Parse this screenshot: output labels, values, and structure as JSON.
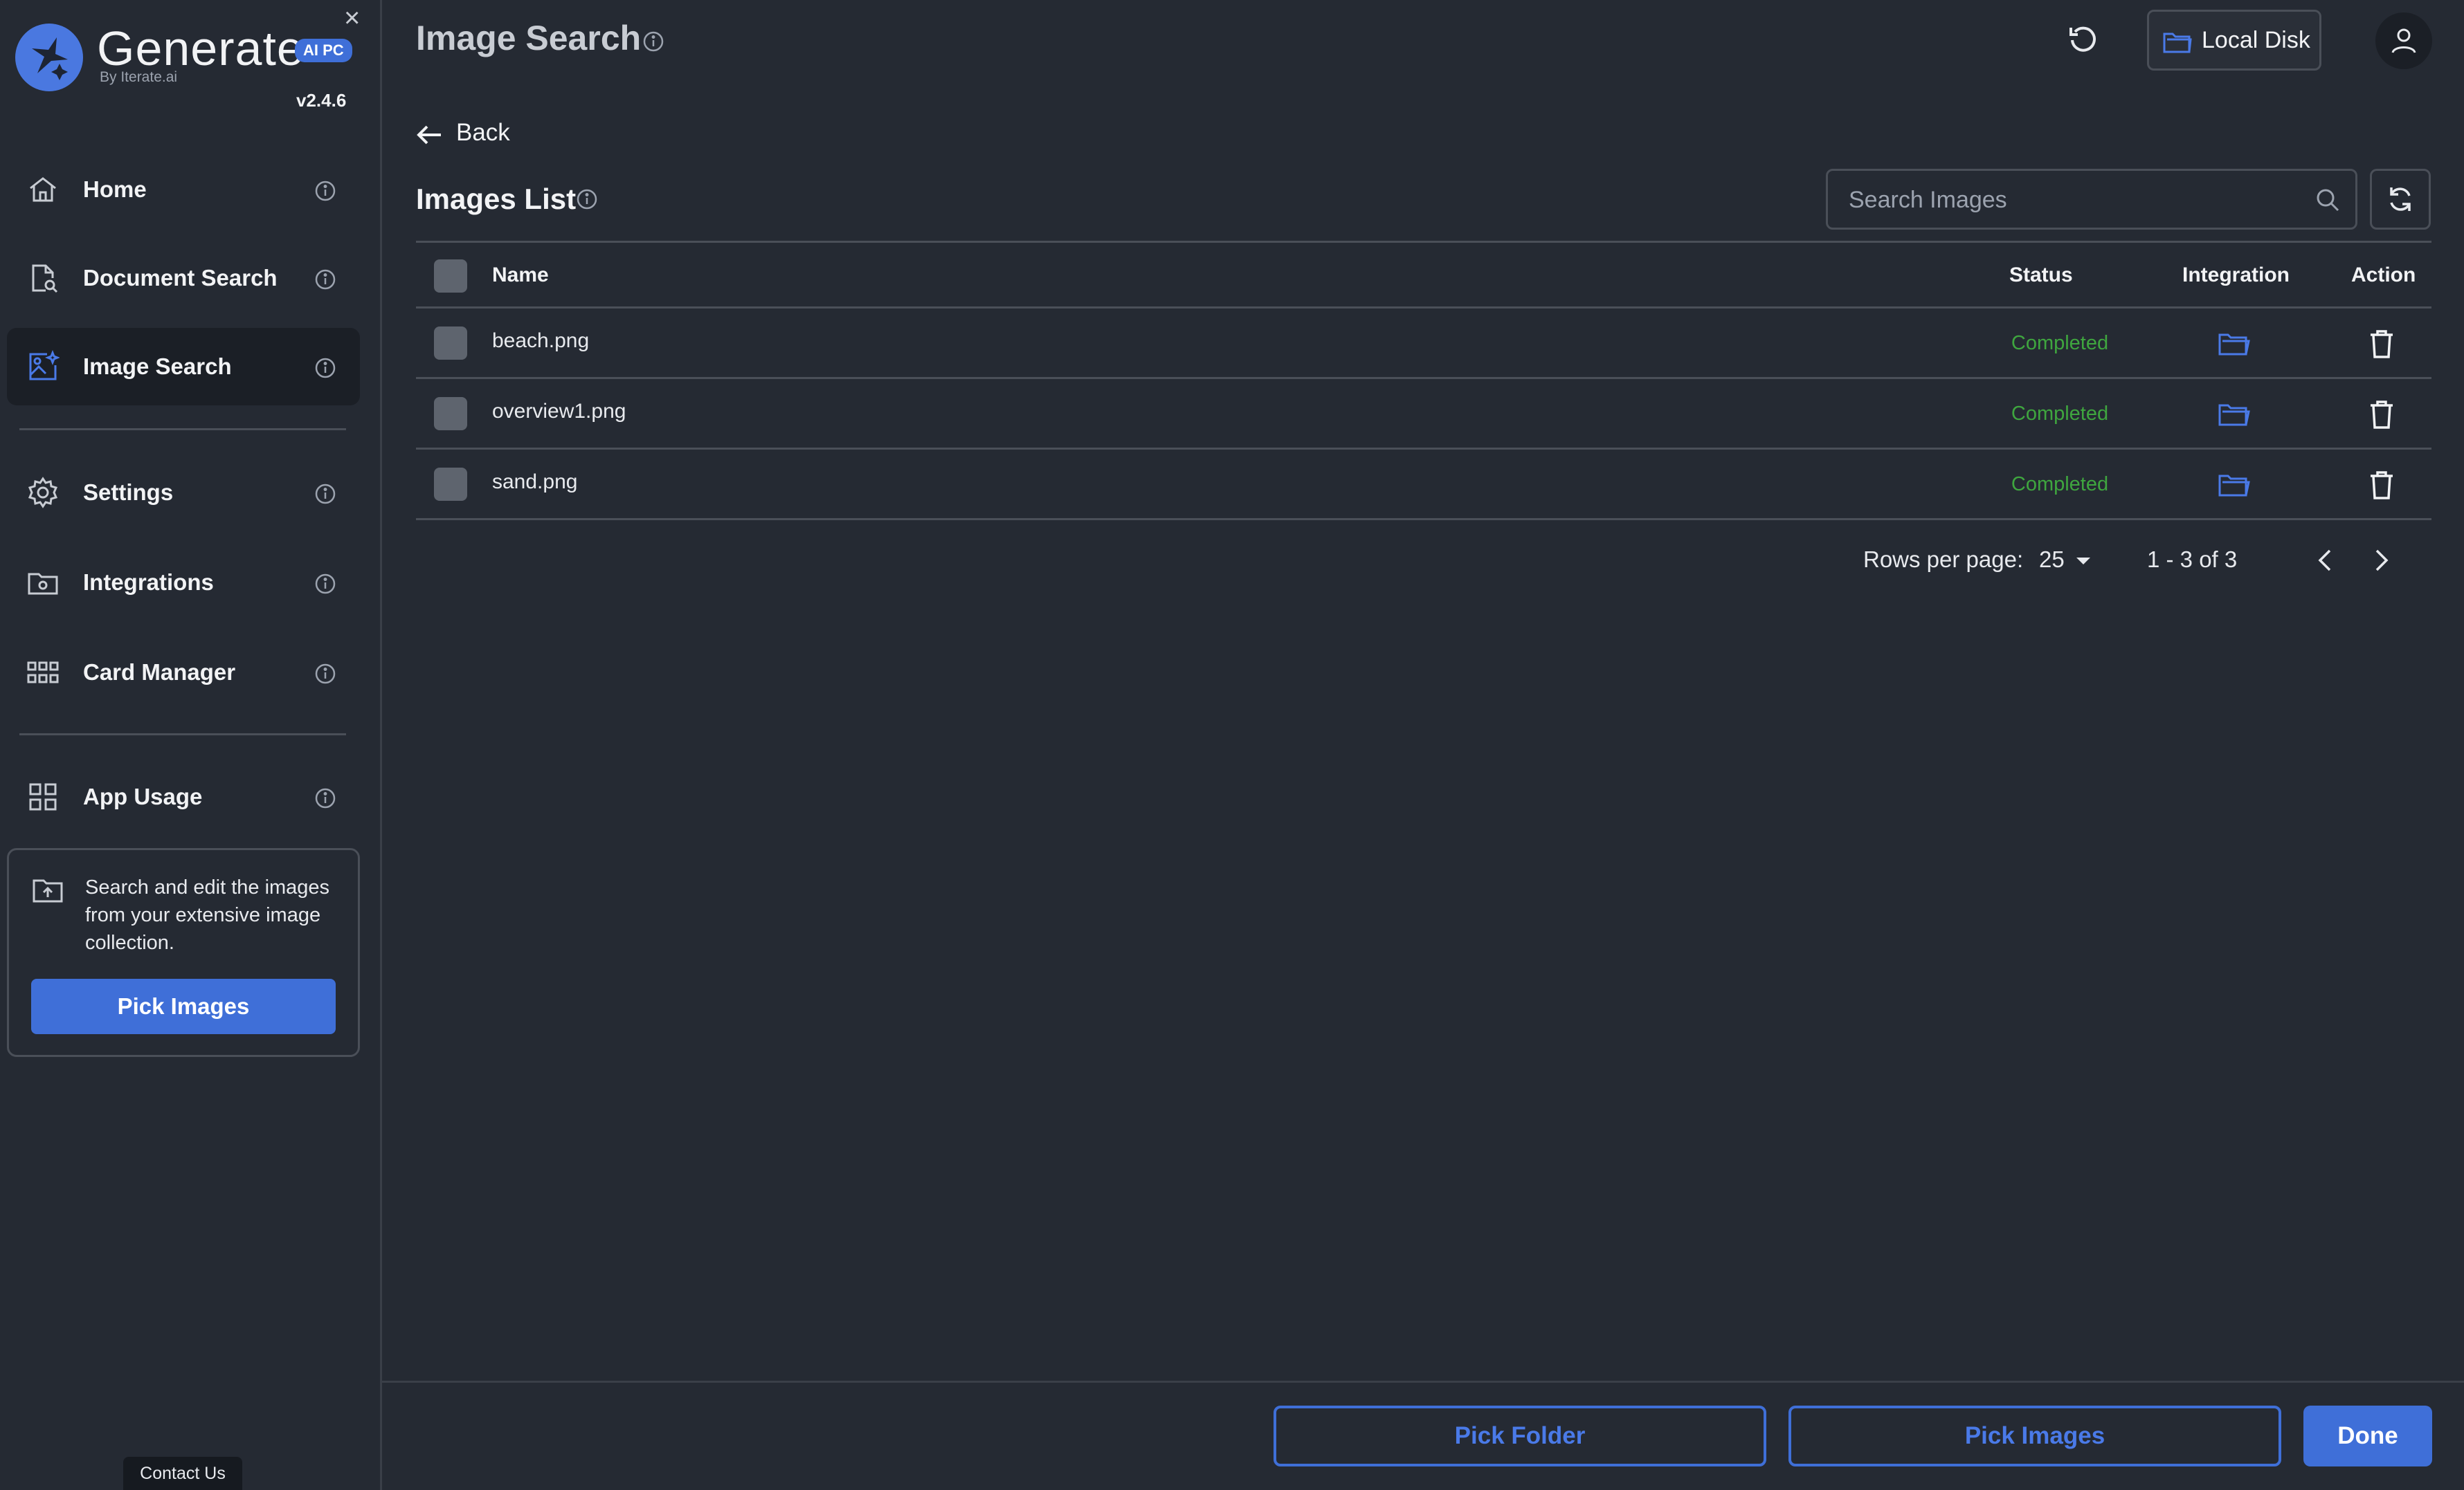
{
  "app": {
    "name": "Generate",
    "badge": "AI PC",
    "byline": "By Iterate.ai",
    "version": "v2.4.6",
    "close_icon": "close-icon"
  },
  "sidebar": {
    "items": [
      {
        "label": "Home",
        "icon": "home-icon",
        "active": false
      },
      {
        "label": "Document Search",
        "icon": "document-search-icon",
        "active": false
      },
      {
        "label": "Image Search",
        "icon": "image-search-icon",
        "active": true
      },
      {
        "label": "Settings",
        "icon": "gear-icon",
        "active": false
      },
      {
        "label": "Integrations",
        "icon": "integrations-folder-icon",
        "active": false
      },
      {
        "label": "Card Manager",
        "icon": "grid-icon",
        "active": false
      },
      {
        "label": "App Usage",
        "icon": "app-grid-icon",
        "active": false
      }
    ],
    "promo": {
      "text": "Search and edit the images from your extensive image collection.",
      "button": "Pick Images"
    },
    "contact": "Contact Us"
  },
  "header": {
    "title": "Image Search",
    "storage": "Local Disk"
  },
  "main": {
    "back": "Back",
    "list_title": "Images List",
    "search_placeholder": "Search Images",
    "columns": {
      "name": "Name",
      "status": "Status",
      "integration": "Integration",
      "action": "Action"
    },
    "rows": [
      {
        "name": "beach.png",
        "status": "Completed"
      },
      {
        "name": "overview1.png",
        "status": "Completed"
      },
      {
        "name": "sand.png",
        "status": "Completed"
      }
    ],
    "pagination": {
      "rows_label": "Rows per page:",
      "rows_value": "25",
      "range": "1 - 3 of 3"
    }
  },
  "footer": {
    "pick_folder": "Pick Folder",
    "pick_images": "Pick Images",
    "done": "Done"
  },
  "colors": {
    "background": "#252a33",
    "accent": "#3f6fd8",
    "status_completed": "#3fa63f"
  }
}
